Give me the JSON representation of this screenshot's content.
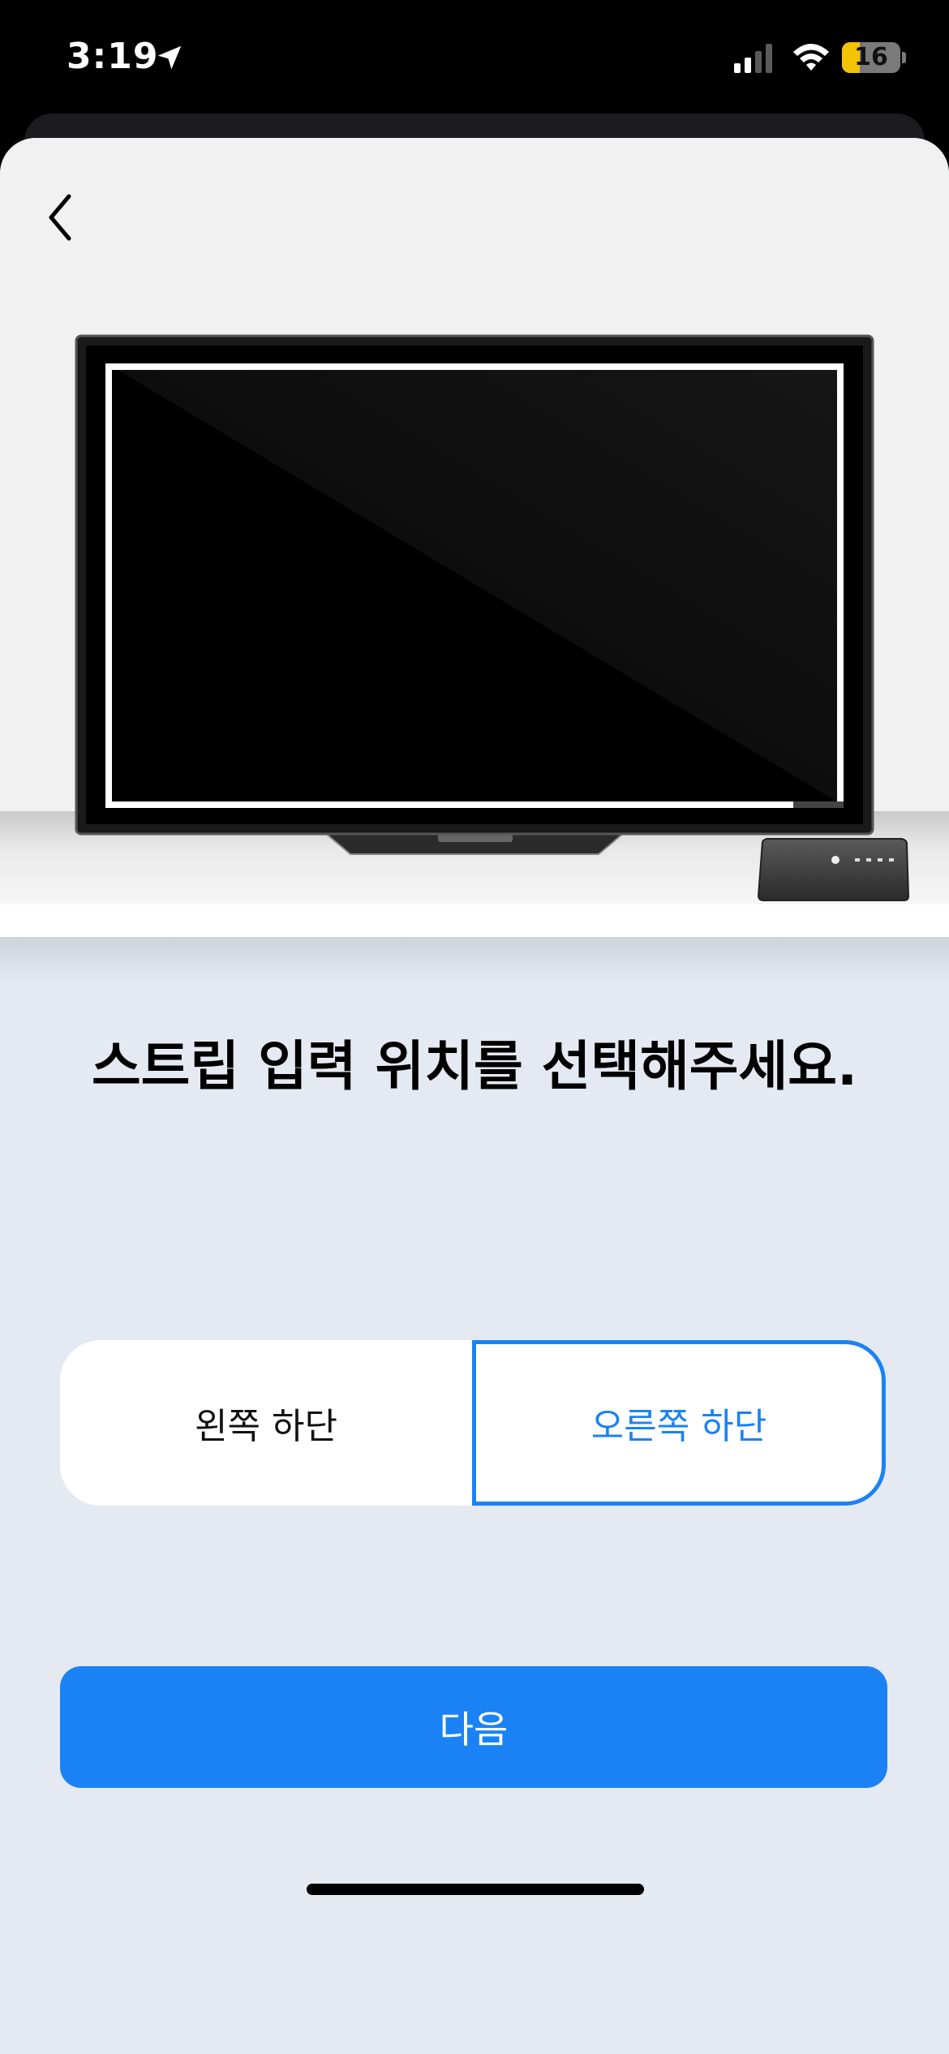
{
  "status_bar": {
    "time": "3:19",
    "battery_level": "16",
    "icons": [
      "location-arrow-icon",
      "signal-icon",
      "wifi-icon",
      "battery-icon"
    ]
  },
  "nav": {
    "back_icon": "chevron-left-icon"
  },
  "illustration": {
    "icons": [
      "tv-icon",
      "set-top-box-icon"
    ]
  },
  "title": "스트립 입력 위치를 선택해주세요.",
  "options": [
    {
      "label": "왼쪽 하단",
      "selected": false
    },
    {
      "label": "오른쪽 하단",
      "selected": true
    }
  ],
  "next_button": {
    "label": "다음"
  },
  "colors": {
    "accent": "#1a82f5",
    "background": "#e5e9f1",
    "battery_fill": "#f5c400"
  }
}
